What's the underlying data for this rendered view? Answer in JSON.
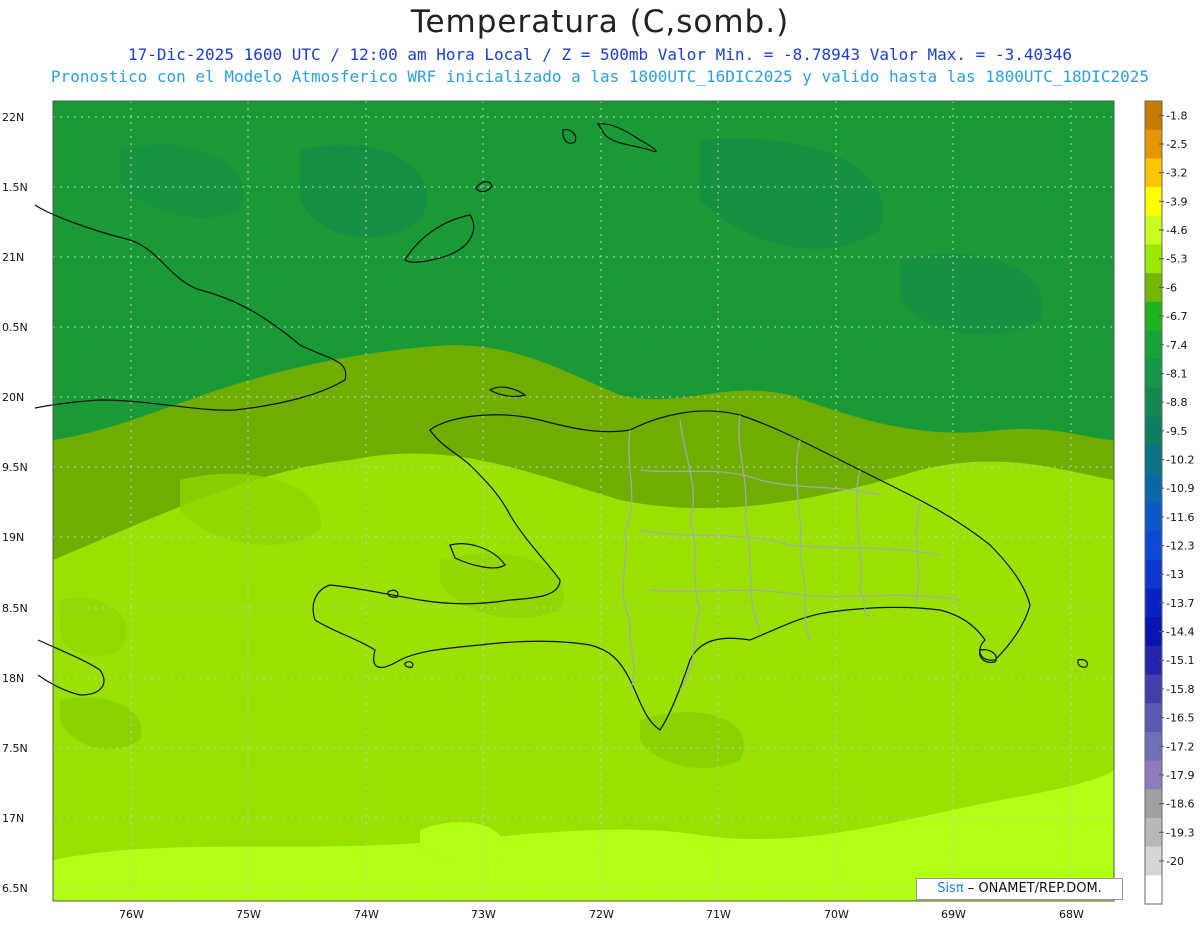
{
  "title": "Temperatura (C,somb.)",
  "subtitle_line1": "17-Dic-2025  1600 UTC / 12:00 am Hora Local / Z = 500mb  Valor Min. = -8.78943  Valor Max. = -3.40346",
  "subtitle_line2": "Pronostico con el Modelo Atmosferico WRF inicializado a las 1800UTC_16DIC2025 y valido hasta las  1800UTC_18DIC2025",
  "y_axis_labels": [
    "22N",
    "1.5N",
    "21N",
    "0.5N",
    "20N",
    "9.5N",
    "19N",
    "8.5N",
    "18N",
    "7.5N",
    "17N",
    "6.5N"
  ],
  "x_axis_labels": [
    "76W",
    "75W",
    "74W",
    "73W",
    "72W",
    "71W",
    "70W",
    "69W",
    "68W"
  ],
  "colorbar": {
    "labels": [
      "-1.8",
      "-2.5",
      "-3.2",
      "-3.9",
      "-4.6",
      "-5.3",
      "-6",
      "-6.7",
      "-7.4",
      "-8.1",
      "-8.8",
      "-9.5",
      "-10.2",
      "-10.9",
      "-11.6",
      "-12.3",
      "-13",
      "-13.7",
      "-14.4",
      "-15.1",
      "-15.8",
      "-16.5",
      "-17.2",
      "-17.9",
      "-18.6",
      "-19.3",
      "-20"
    ],
    "colors": [
      "#c57a00",
      "#e59500",
      "#ffc400",
      "#ffff00",
      "#c8ff1e",
      "#9be800",
      "#72b800",
      "#1eb41e",
      "#17a23c",
      "#159649",
      "#13894f",
      "#0f7d63",
      "#0a7485",
      "#0a67a8",
      "#0c58c8",
      "#0c49d6",
      "#0c38d0",
      "#0a22c4",
      "#0a14b0",
      "#2424ac",
      "#4040ac",
      "#5a5ab4",
      "#7070b8",
      "#8e7cb8",
      "#a0a0a0",
      "#b8b8b8",
      "#d6d6d6",
      "#ffffff"
    ]
  },
  "credit": {
    "brand": "Sisπ",
    "text": " – ONAMET/REP.DOM."
  },
  "field_colors": {
    "northern_band": "#1a9a36",
    "mid_band": "#6fae00",
    "southern_band": "#98e100",
    "far_south": "#b0ff14"
  }
}
